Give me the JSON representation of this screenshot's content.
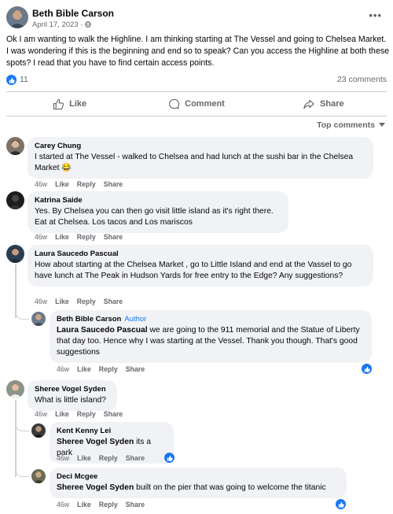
{
  "post": {
    "author": "Beth Bible Carson",
    "date": "April 17, 2023 ·",
    "more_icon": "•••",
    "text": "Ok I am wanting to walk the Highline. I am thinking starting at The Vessel and going to Chelsea Market. I was wondering if this is the beginning and end so to speak? Can you access the Highline at both these spots? I read that you have to find certain access points.",
    "likes": "11",
    "comments": "23 comments"
  },
  "actions": {
    "like": "Like",
    "comment": "Comment",
    "share": "Share"
  },
  "sort": "Top comments",
  "comments": [
    {
      "name": "Carey Chung",
      "text": "I started at The Vessel - walked to Chelsea and had lunch at the sushi bar in the Chelsea Market",
      "emoji": "😂",
      "time": "46w",
      "like": "Like",
      "reply": "Reply",
      "share": "Share"
    },
    {
      "name": "Katrina Saide",
      "text": "Yes. By Chelsea you can then go visit little island as it's right there. Eat at Chelsea. Los tacos and Los mariscos",
      "time": "46w",
      "like": "Like",
      "reply": "Reply",
      "share": "Share"
    },
    {
      "name": "Laura Saucedo Pascual",
      "text": "How about starting at the Chelsea Market , go to Little Island and end at the Vassel to go have lunch at The Peak in Hudson Yards for free entry to the Edge? Any suggestions?",
      "time": "46w",
      "like": "Like",
      "reply": "Reply",
      "share": "Share"
    },
    {
      "name": "Beth Bible Carson",
      "author_tag": "Author",
      "mention": "Laura Saucedo Pascual",
      "text": " we are going to the 911 memorial and the Statue of Liberty that day too. Hence why I was starting at the Vessel. Thank you though. That's good suggestions",
      "time": "46w",
      "like": "Like",
      "reply": "Reply",
      "share": "Share"
    },
    {
      "name": "Sheree Vogel Syden",
      "text": "What is little island?",
      "time": "46w",
      "like": "Like",
      "reply": "Reply",
      "share": "Share"
    },
    {
      "name": "Kent Kenny Lei",
      "mention": "Sheree Vogel Syden",
      "text": " its a park",
      "time": "46w",
      "like": "Like",
      "reply": "Reply",
      "share": "Share"
    },
    {
      "name": "Deci Mcgee",
      "mention": "Sheree Vogel Syden",
      "text": " built on the pier that was going to welcome the titanic",
      "time": "46w",
      "like": "Like",
      "reply": "Reply",
      "share": "Share"
    }
  ],
  "colors": {
    "accent": "#1877f2",
    "bubble": "#f0f2f5",
    "muted": "#65676b"
  }
}
